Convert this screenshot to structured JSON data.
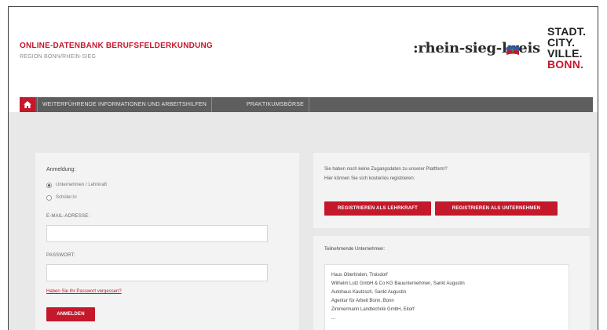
{
  "header": {
    "title": "ONLINE-DATENBANK BERUFSFELDERKUNDUNG",
    "subtitle": "REGION BONN/RHEIN-SIEG",
    "rsk_logo": ":rhein-sieg-kreis",
    "bonn_logo": [
      "STADT.",
      "CITY.",
      "VILLE.",
      "BONN."
    ]
  },
  "nav": {
    "home_icon": "home-icon",
    "items": [
      "WEITERFÜHRENDE INFORMATIONEN UND ARBEITSHILFEN",
      "PRAKTIKUMSBÖRSE"
    ]
  },
  "login": {
    "title": "Anmeldung:",
    "radio_options": [
      "Unternehmen / Lehrkraft",
      "Schüler:in"
    ],
    "selected_option": "Unternehmen / Lehrkraft",
    "email_label": "E-MAIL-ADRESSE:",
    "email_value": "",
    "password_label": "PASSWORT:",
    "password_value": "",
    "forgot_link": "Haben Sie Ihr Passwort vergessen?",
    "login_button": "ANMELDEN"
  },
  "register": {
    "text_line1": "Sie haben noch keine Zugangsdaten zu unserer Plattform?",
    "text_line2": "Hier können Sie sich kostenlos registrieren:",
    "button_teacher": "REGISTRIEREN ALS LEHRKRAFT",
    "button_company": "REGISTRIEREN ALS UNTERNEHMEN"
  },
  "companies": {
    "title": "Teilnehmende Unternehmen:",
    "items": [
      "Haus Oberlinden, Troisdorf",
      "Wilhelm Lutz GmbH & Co KG Bauunternehmen, Sankt Augustin",
      "Autohaus Kautzsch, Sankt Augustin",
      "Agentur für Arbeit Bonn, Bonn",
      "Zimmermann Landtechnik GmbH, Eitorf",
      "..."
    ]
  },
  "colors": {
    "brand_red": "#c4182b",
    "nav_gray": "#5e5e5e",
    "panel_bg": "#f3f3f3",
    "page_gray": "#e8e8e8"
  }
}
